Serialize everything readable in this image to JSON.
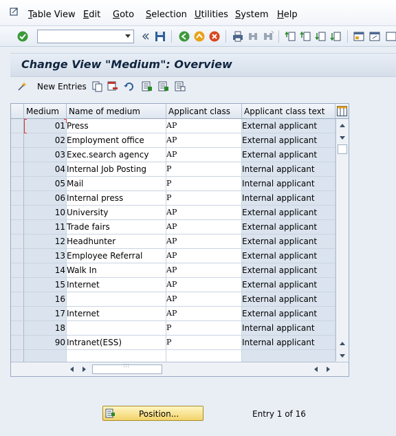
{
  "menu": {
    "items": [
      {
        "first": "T",
        "rest": "able View"
      },
      {
        "first": "E",
        "rest": "dit"
      },
      {
        "first": "G",
        "rest": "oto"
      },
      {
        "first": "S",
        "rest": "election"
      },
      {
        "first": "U",
        "rest": "tilities"
      },
      {
        "first": "S",
        "rest": "ystem"
      },
      {
        "first": "H",
        "rest": "elp"
      }
    ]
  },
  "toolbar": {
    "command_value": ""
  },
  "title": "Change View \"Medium\": Overview",
  "app_toolbar": {
    "new_entries_label": "New Entries"
  },
  "table": {
    "columns": [
      "Medium",
      "Name of medium",
      "Applicant class",
      "Applicant class text"
    ],
    "rows": [
      {
        "medium": "01",
        "name": "Press",
        "class": "AP",
        "class_text": "External applicant"
      },
      {
        "medium": "02",
        "name": "Employment office",
        "class": "AP",
        "class_text": "External applicant"
      },
      {
        "medium": "03",
        "name": "Exec.search agency",
        "class": "AP",
        "class_text": "External applicant"
      },
      {
        "medium": "04",
        "name": "Internal Job Posting",
        "class": "P",
        "class_text": "Internal applicant"
      },
      {
        "medium": "05",
        "name": "Mail",
        "class": "P",
        "class_text": "Internal applicant"
      },
      {
        "medium": "06",
        "name": "Internal press",
        "class": "P",
        "class_text": "Internal applicant"
      },
      {
        "medium": "10",
        "name": "University",
        "class": "AP",
        "class_text": "External applicant"
      },
      {
        "medium": "11",
        "name": "Trade fairs",
        "class": "AP",
        "class_text": "External applicant"
      },
      {
        "medium": "12",
        "name": "Headhunter",
        "class": "AP",
        "class_text": "External applicant"
      },
      {
        "medium": "13",
        "name": "Employee Referral",
        "class": "AP",
        "class_text": "External applicant"
      },
      {
        "medium": "14",
        "name": "Walk In",
        "class": "AP",
        "class_text": "External applicant"
      },
      {
        "medium": "15",
        "name": "Internet",
        "class": "AP",
        "class_text": "External applicant"
      },
      {
        "medium": "16",
        "name": "",
        "class": "AP",
        "class_text": "External applicant"
      },
      {
        "medium": "17",
        "name": "Internet",
        "class": "AP",
        "class_text": "External applicant"
      },
      {
        "medium": "18",
        "name": "",
        "class": "P",
        "class_text": "Internal applicant"
      },
      {
        "medium": "90",
        "name": "Intranet(ESS)",
        "class": "P",
        "class_text": "Internal applicant"
      },
      {
        "medium": "",
        "name": "",
        "class": "",
        "class_text": ""
      }
    ]
  },
  "footer": {
    "position_label": "Position...",
    "entry_info": "Entry 1 of 16"
  },
  "colors": {
    "title_text": "#10253f",
    "position_button": "#f3d36b"
  }
}
